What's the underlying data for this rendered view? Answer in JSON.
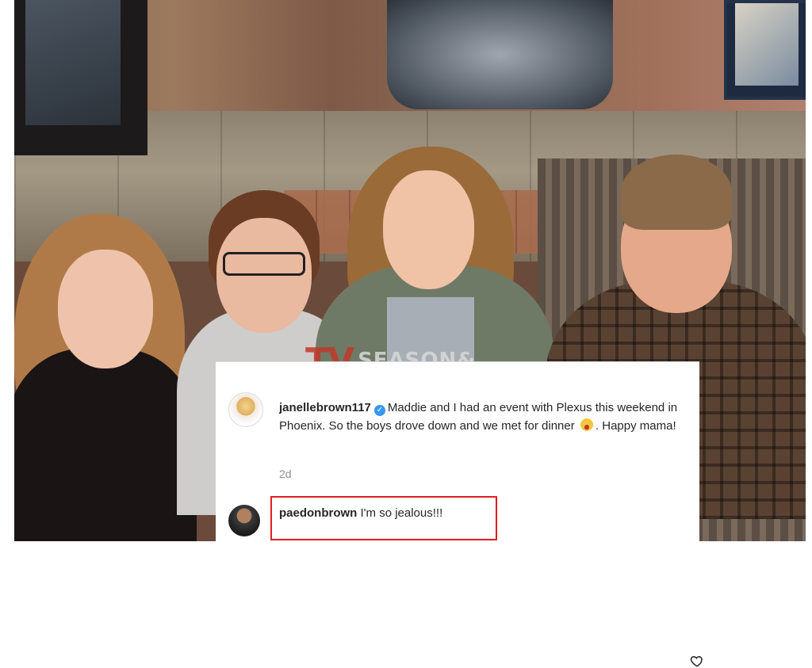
{
  "watermark": {
    "logo": "TV",
    "text": "SEASON&"
  },
  "post": {
    "username": "janellebrown117",
    "caption_before_emoji": "Maddie and I had an event with Plexus this weekend in Phoenix. So the boys drove down and we met for dinner",
    "caption_after_emoji": ". Happy mama!",
    "timestamp": "2d"
  },
  "reply": {
    "username": "paedonbrown",
    "text": "I'm so jealous!!!"
  },
  "icons": {
    "verified": "verified-badge-icon",
    "emoji": "grinning-emoji-icon",
    "like": "heart-icon"
  },
  "colors": {
    "highlight": "#e01e1e",
    "verified": "#3897f0",
    "watermark_red": "#c0392b"
  }
}
